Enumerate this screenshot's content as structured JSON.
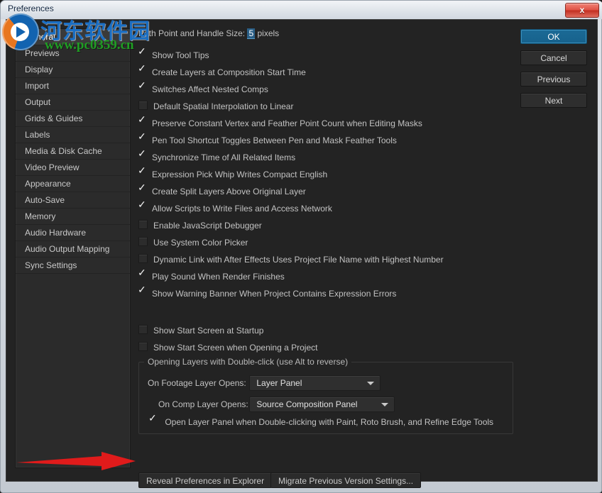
{
  "window": {
    "title": "Preferences",
    "close_label": "x",
    "close_icon": "close-icon"
  },
  "sidebar": {
    "items": [
      {
        "label": "General",
        "selected": true
      },
      {
        "label": "Previews",
        "selected": false
      },
      {
        "label": "Display",
        "selected": false
      },
      {
        "label": "Import",
        "selected": false
      },
      {
        "label": "Output",
        "selected": false
      },
      {
        "label": "Grids & Guides",
        "selected": false
      },
      {
        "label": "Labels",
        "selected": false
      },
      {
        "label": "Media & Disk Cache",
        "selected": false
      },
      {
        "label": "Video Preview",
        "selected": false
      },
      {
        "label": "Appearance",
        "selected": false
      },
      {
        "label": "Auto-Save",
        "selected": false
      },
      {
        "label": "Memory",
        "selected": false
      },
      {
        "label": "Audio Hardware",
        "selected": false
      },
      {
        "label": "Audio Output Mapping",
        "selected": false
      },
      {
        "label": "Sync Settings",
        "selected": false
      }
    ]
  },
  "buttons": {
    "ok": "OK",
    "cancel": "Cancel",
    "previous": "Previous",
    "next": "Next"
  },
  "content": {
    "path_point": {
      "label_prefix": "Path Point and Handle Size:",
      "value": "5",
      "unit": "pixels"
    },
    "checkboxes_group1": [
      {
        "label": "Show Tool Tips",
        "checked": true
      },
      {
        "label": "Create Layers at Composition Start Time",
        "checked": true
      },
      {
        "label": "Switches Affect Nested Comps",
        "checked": true
      },
      {
        "label": "Default Spatial Interpolation to Linear",
        "checked": false
      },
      {
        "label": "Preserve Constant Vertex and Feather Point Count when Editing Masks",
        "checked": true
      },
      {
        "label": "Pen Tool Shortcut Toggles Between Pen and Mask Feather Tools",
        "checked": true
      },
      {
        "label": "Synchronize Time of All Related Items",
        "checked": true
      },
      {
        "label": "Expression Pick Whip Writes Compact English",
        "checked": true
      },
      {
        "label": "Create Split Layers Above Original Layer",
        "checked": true
      },
      {
        "label": "Allow Scripts to Write Files and Access Network",
        "checked": true
      },
      {
        "label": "Enable JavaScript Debugger",
        "checked": false
      },
      {
        "label": "Use System Color Picker",
        "checked": false
      },
      {
        "label": "Dynamic Link with After Effects Uses Project File Name with Highest Number",
        "checked": false
      },
      {
        "label": "Play Sound When Render Finishes",
        "checked": true
      },
      {
        "label": "Show Warning Banner When Project Contains Expression Errors",
        "checked": true
      }
    ],
    "checkboxes_group2": [
      {
        "label": "Show Start Screen at Startup",
        "checked": false
      },
      {
        "label": "Show Start Screen when Opening a Project",
        "checked": false
      }
    ],
    "group": {
      "legend": "Opening Layers with Double-click (use Alt to reverse)",
      "footage_label": "On Footage Layer Opens:",
      "footage_value": "Layer Panel",
      "comp_label": "On Comp Layer Opens:",
      "comp_value": "Source Composition Panel",
      "open_layer_checkbox": {
        "label": "Open Layer Panel when Double-clicking with Paint, Roto Brush, and Refine Edge Tools",
        "checked": true
      }
    }
  },
  "bottom": {
    "reveal": "Reveal Preferences in Explorer",
    "migrate": "Migrate Previous Version Settings..."
  },
  "watermark": {
    "cn_text": "河东软件园",
    "url_text": "www.pc0359.cn"
  },
  "colors": {
    "accent": "#17628c",
    "dialog_bg": "#232323",
    "sidebar_bg": "#2b2b2b",
    "annotation_arrow": "#e01b1b",
    "watermark_blue": "#1b6fc4",
    "watermark_green": "#1f9e23",
    "close_red": "#df5245"
  }
}
